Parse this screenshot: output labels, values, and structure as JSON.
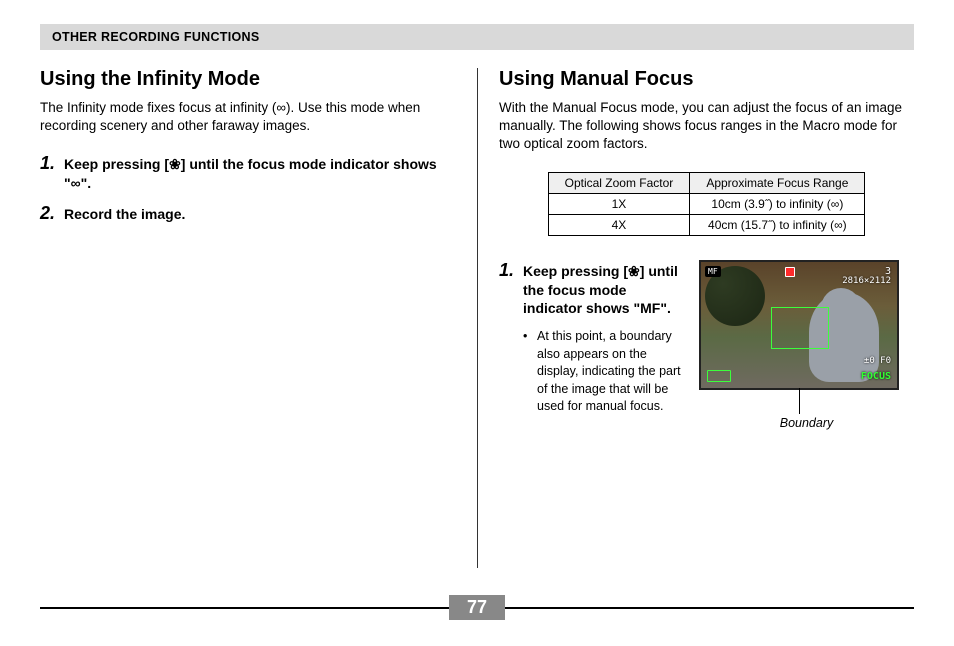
{
  "header": "OTHER RECORDING FUNCTIONS",
  "pageNumber": "77",
  "left": {
    "title": "Using the Infinity Mode",
    "intro": "The Infinity mode fixes focus at infinity (∞). Use this mode when recording scenery and other faraway images.",
    "steps": [
      {
        "num": "1.",
        "text_prefix": "Keep pressing [",
        "icon": "flower-icon",
        "text_suffix": "] until the focus mode indicator shows \"∞\"."
      },
      {
        "num": "2.",
        "text": "Record the image."
      }
    ]
  },
  "right": {
    "title": "Using Manual Focus",
    "intro": "With the Manual Focus mode, you can adjust the focus of an image manually. The following shows focus ranges in the Macro mode for two optical zoom factors.",
    "table": {
      "headers": [
        "Optical Zoom Factor",
        "Approximate Focus Range"
      ],
      "rows": [
        [
          "1X",
          "10cm (3.9˝) to infinity (∞)"
        ],
        [
          "4X",
          "40cm (15.7˝) to infinity (∞)"
        ]
      ]
    },
    "step": {
      "num": "1.",
      "text_prefix": "Keep pressing [",
      "icon": "flower-icon",
      "text_suffix": "] until the focus mode indicator shows \"MF\".",
      "bullet": "At this point, a boundary also appears on the display, indicating the part of the image that will be used for manual focus."
    },
    "lcd": {
      "mf": "MF",
      "shots": "3",
      "resolution": "2816×2112",
      "ev": "±0 F0",
      "focus": "FOCUS"
    },
    "boundaryLabel": "Boundary"
  }
}
